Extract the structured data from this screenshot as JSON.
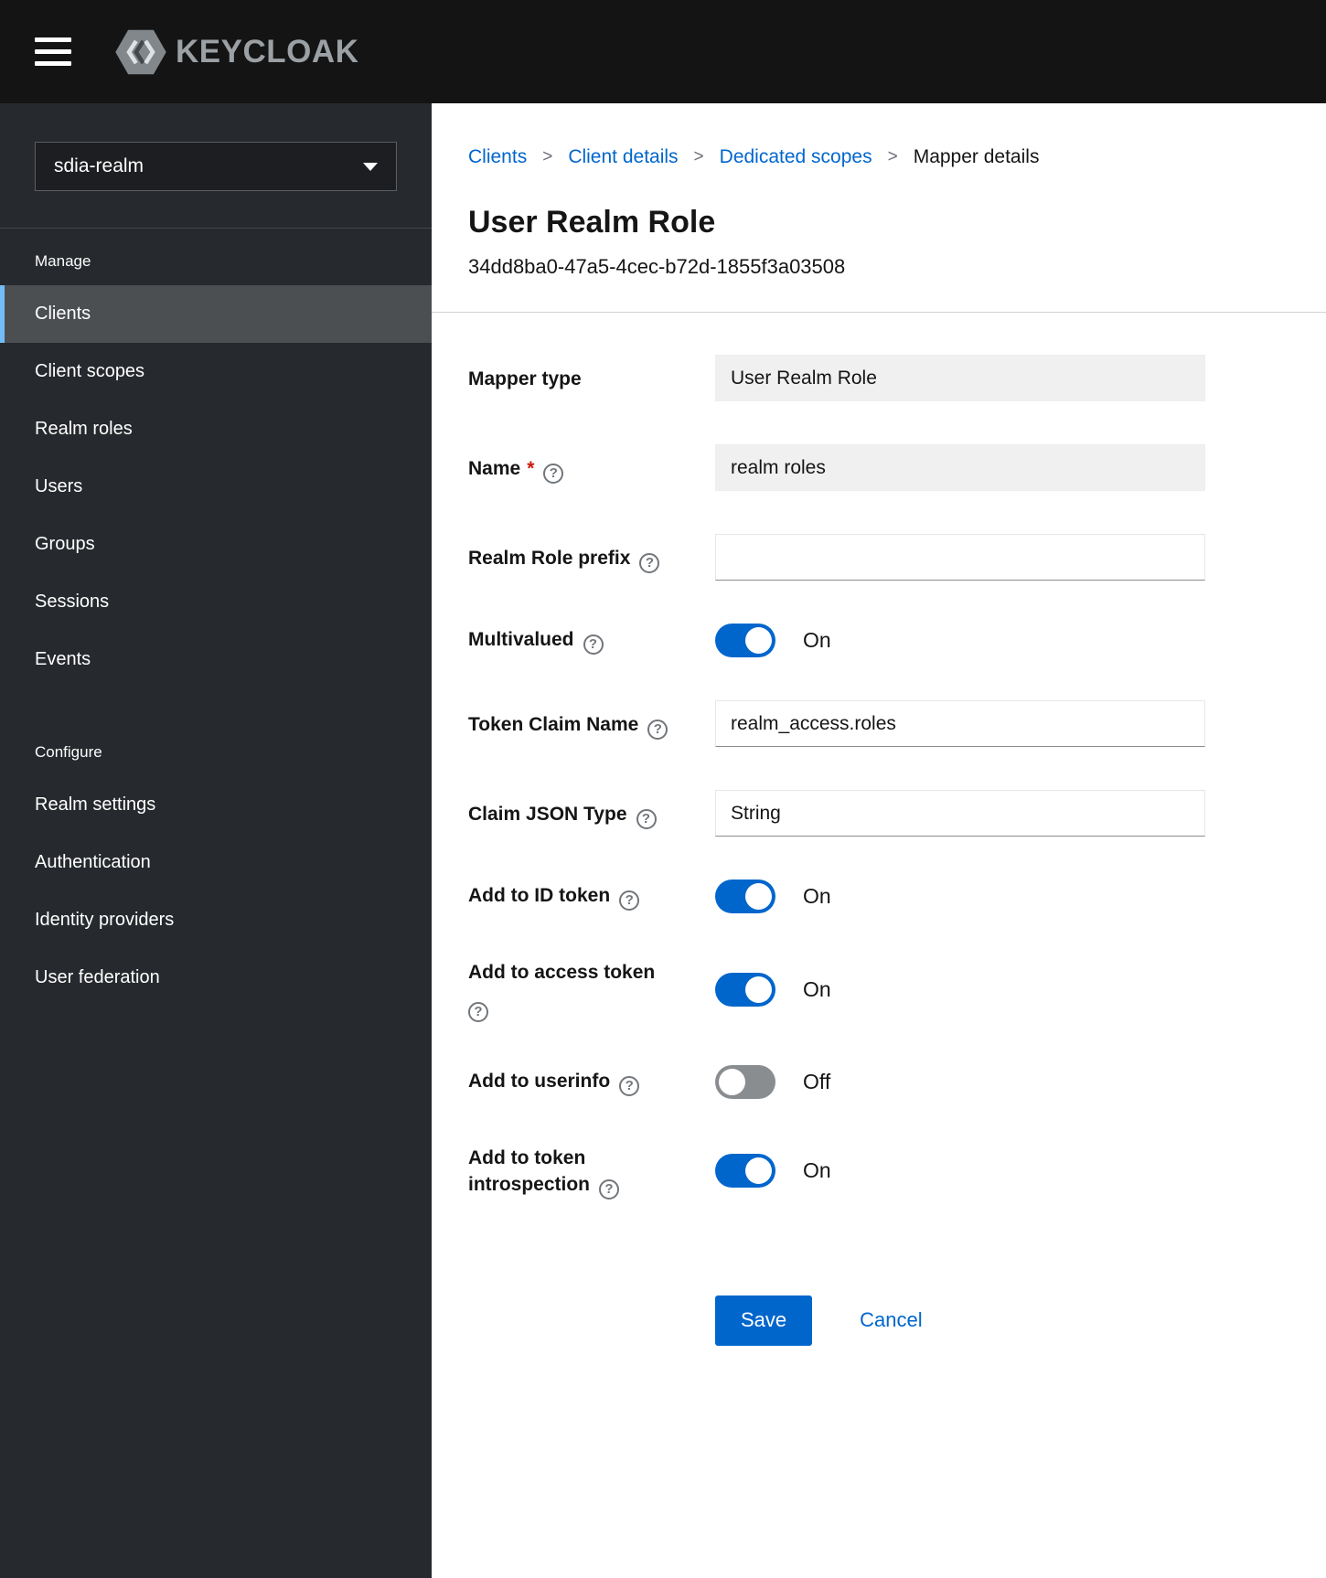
{
  "colors": {
    "accent": "#0066cc",
    "header_bg": "#141414",
    "sidebar_bg": "#26292d",
    "sidebar_active_bg": "#4c4f52",
    "sidebar_active_border": "#73bcf7",
    "switch_on": "#0066cc",
    "switch_off": "#8a8d90",
    "required": "#c9190b"
  },
  "header": {
    "brand": "KEYCLOAK"
  },
  "sidebar": {
    "realm_selector": {
      "value": "sdia-realm"
    },
    "sections": [
      {
        "title": "Manage",
        "items": [
          {
            "label": "Clients",
            "active": true
          },
          {
            "label": "Client scopes",
            "active": false
          },
          {
            "label": "Realm roles",
            "active": false
          },
          {
            "label": "Users",
            "active": false
          },
          {
            "label": "Groups",
            "active": false
          },
          {
            "label": "Sessions",
            "active": false
          },
          {
            "label": "Events",
            "active": false
          }
        ]
      },
      {
        "title": "Configure",
        "items": [
          {
            "label": "Realm settings",
            "active": false
          },
          {
            "label": "Authentication",
            "active": false
          },
          {
            "label": "Identity providers",
            "active": false
          },
          {
            "label": "User federation",
            "active": false
          }
        ]
      }
    ]
  },
  "breadcrumb": {
    "separator": ">",
    "items": [
      "Clients",
      "Client details",
      "Dedicated scopes",
      "Mapper details"
    ]
  },
  "page": {
    "title": "User Realm Role",
    "subtitle": "34dd8ba0-47a5-4cec-b72d-1855f3a03508"
  },
  "form": {
    "required_marker": "*",
    "help_glyph": "?",
    "fields": [
      {
        "label": "Mapper type",
        "type": "readonly-text",
        "value": "User Realm Role"
      },
      {
        "label": "Name",
        "type": "readonly-text",
        "value": "realm roles",
        "required": true,
        "help": true
      },
      {
        "label": "Realm Role prefix",
        "type": "text",
        "value": "",
        "help": true
      },
      {
        "label": "Multivalued",
        "type": "switch",
        "on": true,
        "state_label": "On",
        "help": true
      },
      {
        "label": "Token Claim Name",
        "type": "text",
        "value": "realm_access.roles",
        "help": true
      },
      {
        "label": "Claim JSON Type",
        "type": "text",
        "value": "String",
        "help": true
      },
      {
        "label": "Add to ID token",
        "type": "switch",
        "on": true,
        "state_label": "On",
        "help": true
      },
      {
        "label": "Add to access token",
        "type": "switch",
        "on": true,
        "state_label": "On",
        "help": true
      },
      {
        "label": "Add to userinfo",
        "type": "switch",
        "on": false,
        "state_label": "Off",
        "help": true
      },
      {
        "label": "Add to token introspection",
        "type": "switch",
        "on": true,
        "state_label": "On",
        "help": true
      }
    ],
    "actions": {
      "save": "Save",
      "cancel": "Cancel"
    }
  }
}
